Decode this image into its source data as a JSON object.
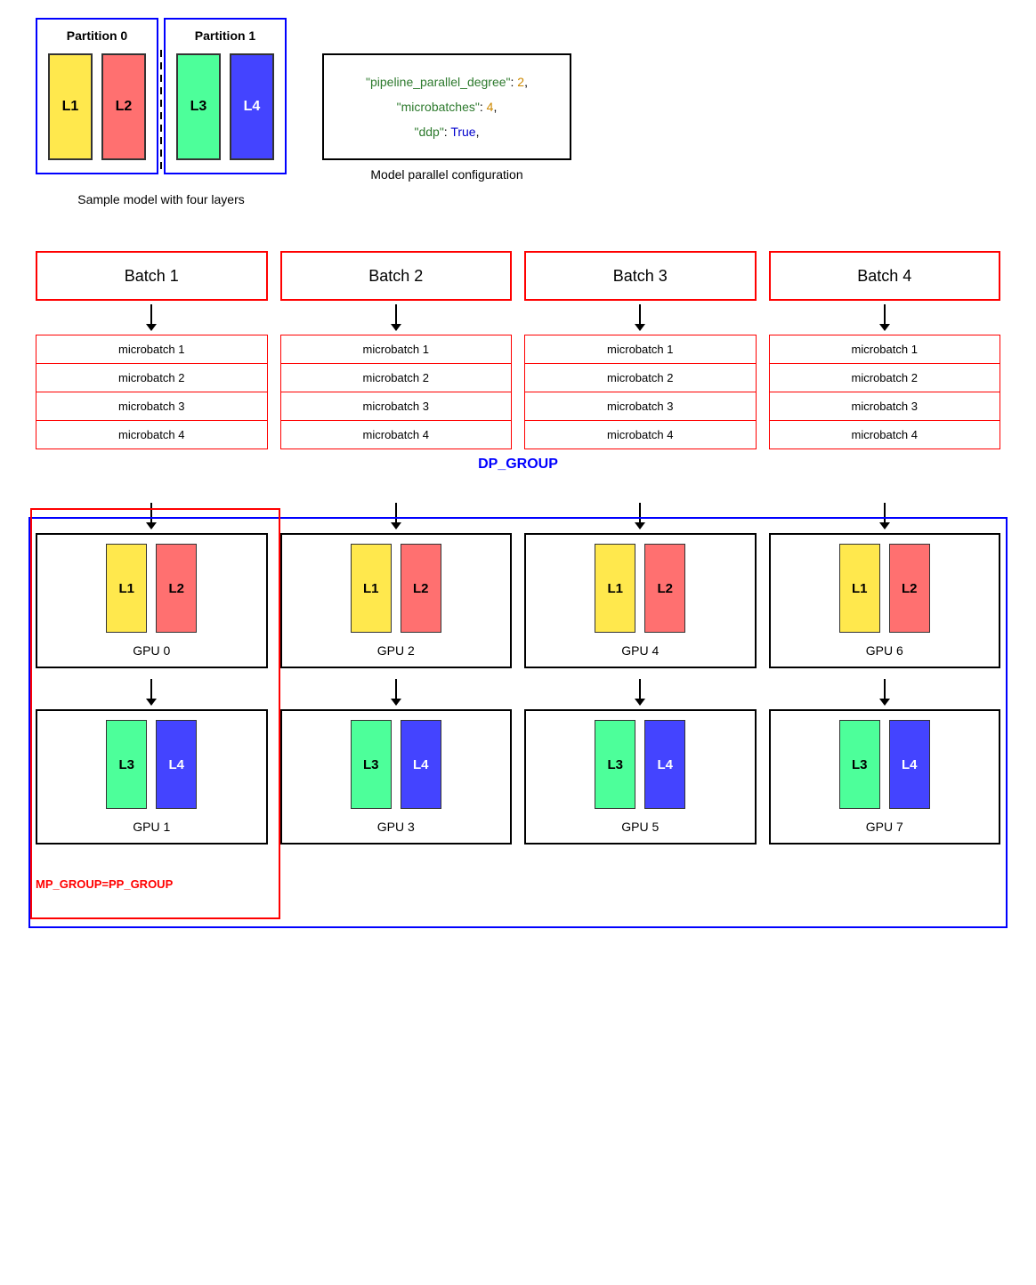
{
  "top": {
    "partitions": [
      {
        "label": "Partition 0",
        "layers": [
          {
            "id": "L1",
            "color": "yellow"
          },
          {
            "id": "L2",
            "color": "red"
          }
        ]
      },
      {
        "label": "Partition 1",
        "layers": [
          {
            "id": "L3",
            "color": "green"
          },
          {
            "id": "L4",
            "color": "blue"
          }
        ]
      }
    ],
    "model_caption": "Sample model with four layers",
    "config": {
      "line1_key": "\"pipeline_parallel_degree\"",
      "line1_val": "2,",
      "line2_key": "\"microbatches\"",
      "line2_val": "4,",
      "line3_key": "\"ddp\"",
      "line3_val": "True,"
    },
    "config_caption": "Model parallel configuration"
  },
  "batches": [
    {
      "label": "Batch 1"
    },
    {
      "label": "Batch 2"
    },
    {
      "label": "Batch 3"
    },
    {
      "label": "Batch 4"
    }
  ],
  "microbatches": [
    "microbatch 1",
    "microbatch 2",
    "microbatch 3",
    "microbatch 4"
  ],
  "dp_group_label": "DP_GROUP",
  "mp_group_label": "MP_GROUP=PP_GROUP",
  "gpus_top": [
    {
      "id": "GPU 0",
      "layers": [
        {
          "id": "L1",
          "color": "yellow"
        },
        {
          "id": "L2",
          "color": "red"
        }
      ]
    },
    {
      "id": "GPU 2",
      "layers": [
        {
          "id": "L1",
          "color": "yellow"
        },
        {
          "id": "L2",
          "color": "red"
        }
      ]
    },
    {
      "id": "GPU 4",
      "layers": [
        {
          "id": "L1",
          "color": "yellow"
        },
        {
          "id": "L2",
          "color": "red"
        }
      ]
    },
    {
      "id": "GPU 6",
      "layers": [
        {
          "id": "L1",
          "color": "yellow"
        },
        {
          "id": "L2",
          "color": "red"
        }
      ]
    }
  ],
  "gpus_bottom": [
    {
      "id": "GPU 1",
      "layers": [
        {
          "id": "L3",
          "color": "green"
        },
        {
          "id": "L4",
          "color": "blue"
        }
      ]
    },
    {
      "id": "GPU 3",
      "layers": [
        {
          "id": "L3",
          "color": "green"
        },
        {
          "id": "L4",
          "color": "blue"
        }
      ]
    },
    {
      "id": "GPU 5",
      "layers": [
        {
          "id": "L3",
          "color": "green"
        },
        {
          "id": "L4",
          "color": "blue"
        }
      ]
    },
    {
      "id": "GPU 7",
      "layers": [
        {
          "id": "L3",
          "color": "green"
        },
        {
          "id": "L4",
          "color": "blue"
        }
      ]
    }
  ]
}
